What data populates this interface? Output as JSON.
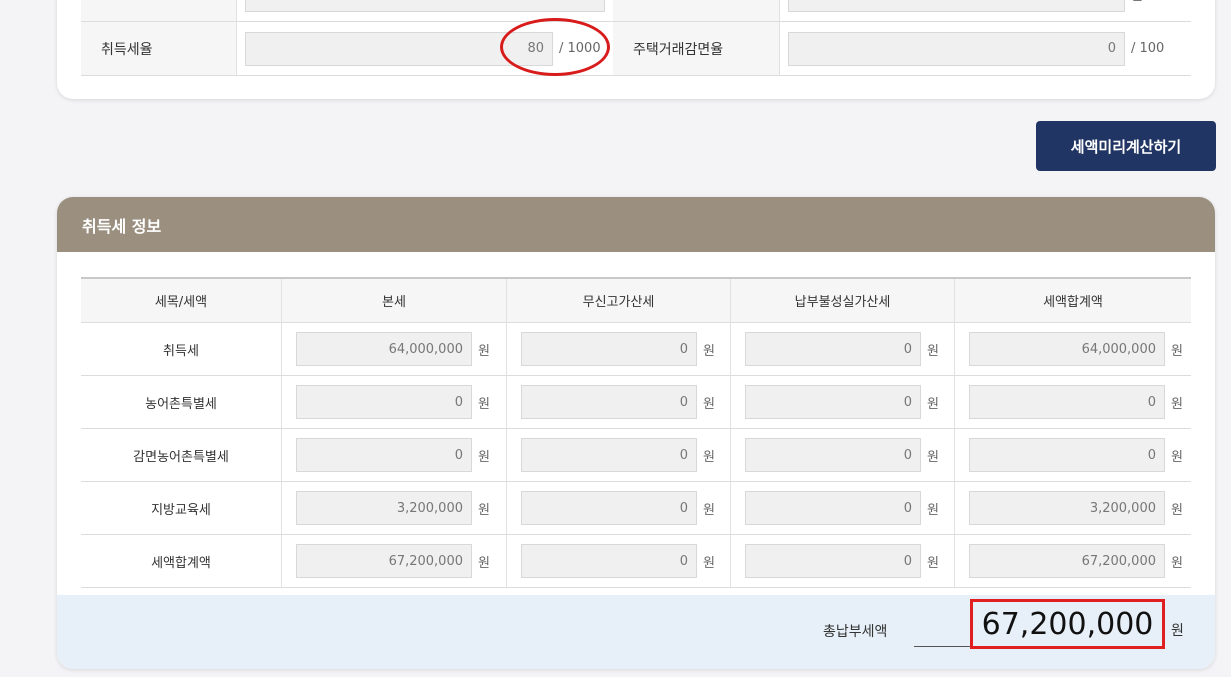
{
  "top_form": {
    "row1": {
      "label_left": "",
      "label_right": "",
      "unit_right": "원"
    },
    "row2": {
      "label_left": "취득세율",
      "value_left": "80",
      "unit_left": "/ 1000",
      "label_right": "주택거래감면율",
      "value_right": "0",
      "unit_right": "/ 100"
    }
  },
  "actions": {
    "preview_button": "세액미리계산하기"
  },
  "info_panel": {
    "title": "취득세 정보",
    "columns": [
      "세목/세액",
      "본세",
      "무신고가산세",
      "납부불성실가산세",
      "세액합계액"
    ],
    "unit": "원",
    "rows": [
      {
        "label": "취득세",
        "values": [
          "64,000,000",
          "0",
          "0",
          "64,000,000"
        ]
      },
      {
        "label": "농어촌특별세",
        "values": [
          "0",
          "0",
          "0",
          "0"
        ]
      },
      {
        "label": "감면농어촌특별세",
        "values": [
          "0",
          "0",
          "0",
          "0"
        ]
      },
      {
        "label": "지방교육세",
        "values": [
          "3,200,000",
          "0",
          "0",
          "3,200,000"
        ]
      },
      {
        "label": "세액합계액",
        "values": [
          "67,200,000",
          "0",
          "0",
          "67,200,000"
        ]
      }
    ],
    "total": {
      "label": "총납부세액",
      "value": "67,200,000",
      "unit": "원"
    }
  },
  "colors": {
    "button": "#203563",
    "panel_header": "#9b9080",
    "total_bar": "#e7f0f8",
    "highlight": "#e02020"
  }
}
